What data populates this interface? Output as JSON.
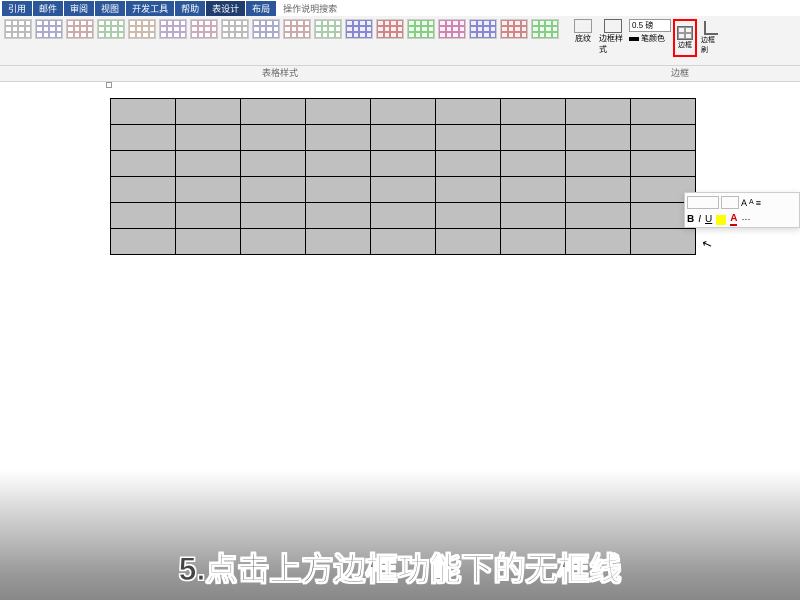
{
  "tabs": {
    "t0": "引用",
    "t1": "邮件",
    "t2": "审阅",
    "t3": "视图",
    "t4": "开发工具",
    "t5": "帮助",
    "t6": "表设计",
    "t7": "布局",
    "t8": "操作说明搜索"
  },
  "ribbon": {
    "styles_label": "表格样式",
    "borders_label": "边框",
    "shading_label": "底纹",
    "border_style_label": "边框样式",
    "weight_value": "0.5 磅",
    "pen_color_label": "笔颜色",
    "borders_btn": "边框",
    "painter_btn": "边框刷"
  },
  "mini_toolbar": {
    "bold": "B",
    "italic": "I",
    "underline": "U",
    "fontcolor": "A",
    "grow": "A",
    "shrink": "A"
  },
  "table": {
    "rows": 6,
    "cols": 9
  },
  "instruction": "5.点击上方边框功能下的无框线"
}
